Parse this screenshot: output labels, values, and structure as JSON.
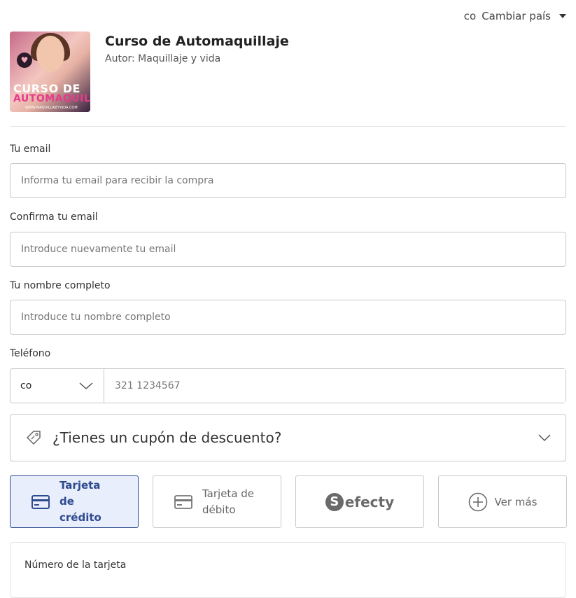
{
  "country": {
    "code": "co",
    "change_label": "Cambiar país"
  },
  "product": {
    "title": "Curso de Automaquillaje",
    "author": "Autor: Maquillaje y vida",
    "thumbnail": {
      "line1": "CURSO DE",
      "line2": "AUTOMAQUILLAJE",
      "footer": "WWW.MAQUILLAJEYVIDA.COM"
    }
  },
  "form": {
    "email": {
      "label": "Tu email",
      "placeholder": "Informa tu email para recibir la compra"
    },
    "confirm_email": {
      "label": "Confirma tu email",
      "placeholder": "Introduce nuevamente tu email"
    },
    "full_name": {
      "label": "Tu nombre completo",
      "placeholder": "Introduce tu nombre completo"
    },
    "phone": {
      "label": "Teléfono",
      "country_code": "co",
      "placeholder": "321 1234567"
    }
  },
  "coupon": {
    "label": "¿Tienes un cupón de descuento?"
  },
  "payment_methods": [
    {
      "label": "Tarjeta de crédito",
      "icon": "credit-card-icon",
      "selected": true
    },
    {
      "label": "Tarjeta de débito",
      "icon": "debit-card-icon",
      "selected": false
    },
    {
      "label": "efecty",
      "icon": "efecty-logo",
      "selected": false
    },
    {
      "label": "Ver más",
      "icon": "plus-circle-icon",
      "selected": false
    }
  ],
  "card": {
    "number_label": "Número de la tarjeta"
  },
  "colors": {
    "accent": "#2e4a8f",
    "selected_bg": "#e8eefb",
    "border": "#c9c9c9"
  }
}
